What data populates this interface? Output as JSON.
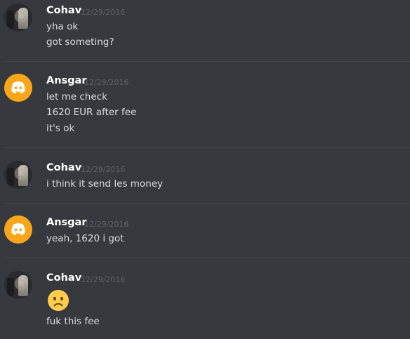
{
  "messages": [
    {
      "author": "Cohav",
      "avatar": "photo-avatar",
      "timestamp": "12/29/2016",
      "lines": [
        "yha ok",
        "got someting?"
      ]
    },
    {
      "author": "Ansgar",
      "avatar": "discord-logo-avatar",
      "avatar_color": "#faa61a",
      "timestamp": "12/29/2016",
      "lines": [
        "let me check",
        "1620 EUR after fee",
        "it's ok"
      ]
    },
    {
      "author": "Cohav",
      "avatar": "photo-avatar",
      "timestamp": "12/29/2016",
      "lines": [
        "i think it send les money"
      ]
    },
    {
      "author": "Ansgar",
      "avatar": "discord-logo-avatar",
      "avatar_color": "#faa61a",
      "timestamp": "12/29/2016",
      "lines": [
        "yeah, 1620 i got"
      ]
    },
    {
      "author": "Cohav",
      "avatar": "photo-avatar",
      "timestamp": "12/29/2016",
      "emoji": "frowning-face-emoji",
      "lines": [
        "fuk this fee"
      ]
    }
  ],
  "colors": {
    "background": "#36393e",
    "username": "#ffffff",
    "message_text": "#dcddde",
    "timestamp": "#5e6167",
    "discord_avatar": "#faa61a",
    "emoji_yellow": "#ffcc4d"
  }
}
